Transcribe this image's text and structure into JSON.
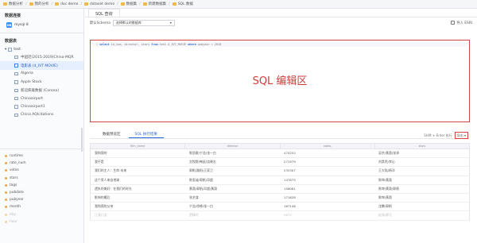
{
  "breadcrumb": [
    {
      "label": "数据分析",
      "icon": "folder-icon"
    },
    {
      "label": "我的分析",
      "icon": "folder-icon"
    },
    {
      "label": "doc demo",
      "icon": "folder-icon"
    },
    {
      "label": "dataset demo",
      "icon": "folder-icon"
    },
    {
      "label": "数据集",
      "icon": "folder-icon"
    },
    {
      "label": "新建数据集",
      "icon": "folder-icon"
    },
    {
      "label": "SQL 数据",
      "icon": "folder-icon"
    }
  ],
  "sidebar": {
    "connection_title": "数据连接",
    "connection_name": "mysql 8",
    "tables_title": "数据表",
    "tree_root": "test",
    "tables": [
      {
        "label": "中国近(2015-2019)China-MQR",
        "active": false
      },
      {
        "label": "电影表 (4_IVT MOVIE)",
        "active": true
      },
      {
        "label": "Algeria",
        "active": false
      },
      {
        "label": "Apple Stock",
        "active": false
      },
      {
        "label": "新冠病毒数据 (Corona)",
        "active": false
      },
      {
        "label": "Chinaairport",
        "active": false
      },
      {
        "label": "Chinaairport1",
        "active": false
      },
      {
        "label": "China AQIcitations",
        "active": false
      }
    ],
    "fields": [
      {
        "label": "runtime",
        "dim": false
      },
      {
        "label": "rate_num",
        "dim": false
      },
      {
        "label": "votes",
        "dim": false
      },
      {
        "label": "stars",
        "dim": false
      },
      {
        "label": "tags",
        "dim": false
      },
      {
        "label": "pubdate",
        "dim": false
      },
      {
        "label": "pubyear",
        "dim": false
      },
      {
        "label": "month",
        "dim": false
      },
      {
        "label": "day",
        "dim": true
      },
      {
        "label": "hour",
        "dim": true
      }
    ]
  },
  "main": {
    "tab_label": "SQL 查询",
    "schema_label": "默认Schema",
    "schema_value": "选择默认的数据库",
    "import_label": "导入 ESRI",
    "editor_line_number": "1",
    "editor_keyword_select": "select",
    "editor_text": "id_num, director, stars",
    "editor_keyword_from": "from",
    "editor_table": "test.4_IVT_MOVIE",
    "editor_keyword_where": "where",
    "editor_condition": "pubyear = 2018",
    "editor_overlay": "SQL 编辑区",
    "result_tabs": [
      {
        "label": "数据预览区",
        "active": false
      },
      {
        "label": "SQL 执行结果",
        "active": true
      }
    ],
    "result_summary": "SHift + Enter 执行",
    "export_label": "导出 ▾"
  },
  "table": {
    "columns": [
      "film_name",
      "director",
      "votes",
      "stars"
    ],
    "rows": [
      [
        "我和我的",
        "陈凯歌/宁浩/张一白",
        "474252",
        "吴京/黄渤/张译"
      ],
      [
        "我不是",
        "文牧野/韩延/饶晓志",
        "271979",
        "刘昊然/李沁"
      ],
      [
        "我们的主人：生命·未来",
        "郭帆/路阳/王家卫",
        "235307",
        "王大陆/杨洋"
      ],
      [
        "这个男人来自地球",
        "陈思诚/郭帆/邓超",
        "147875",
        "陈坤/黄渤"
      ],
      [
        "遗失的美好：在我们的时光",
        "黄渤/郭帆/邓超/黄渤",
        "156081",
        "陈坤/黄渤/郭帆"
      ],
      [
        "影响的最后",
        "张艺谋",
        "171628",
        "陈坤/黄渤"
      ],
      [
        "我和我的父亲",
        "宁浩/徐峥/张一白",
        "167146",
        "沈腾/郭帆"
      ],
      [
        "江湖儿女",
        "贾樟柯",
        "9873",
        "赵涛/廖凡"
      ]
    ]
  },
  "colors": {
    "accent": "#2d63d8",
    "highlight_border": "#d24646",
    "overlay_text": "#d33a3a",
    "folder": "#f2b84b",
    "field_dot": "#f0a63a"
  }
}
